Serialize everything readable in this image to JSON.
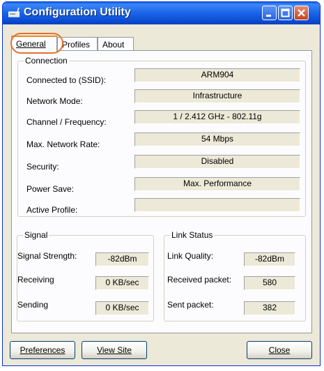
{
  "window": {
    "title": "Configuration Utility"
  },
  "tabs": [
    {
      "label": "General",
      "active": true
    },
    {
      "label": "Profiles",
      "active": false
    },
    {
      "label": "About",
      "active": false
    }
  ],
  "connection": {
    "title": "Connection",
    "rows": [
      {
        "label": "Connected to (SSID):",
        "value": "ARM904"
      },
      {
        "label": "Network Mode:",
        "value": "Infrastructure"
      },
      {
        "label": "Channel / Frequency:",
        "value": "1 / 2.412 GHz - 802.11g"
      },
      {
        "label": "Max. Network Rate:",
        "value": "54 Mbps"
      },
      {
        "label": "Security:",
        "value": "Disabled"
      },
      {
        "label": "Power Save:",
        "value": "Max. Performance"
      },
      {
        "label": "Active Profile:",
        "value": ""
      }
    ]
  },
  "signal": {
    "title": "Signal",
    "rows": [
      {
        "label": "Signal Strength:",
        "value": "-82dBm"
      },
      {
        "label": "Receiving",
        "value": "0 KB/sec"
      },
      {
        "label": "Sending",
        "value": "0 KB/sec"
      }
    ]
  },
  "link_status": {
    "title": "Link Status",
    "rows": [
      {
        "label": "Link Quality:",
        "value": "-82dBm"
      },
      {
        "label": "Received packet:",
        "value": "580"
      },
      {
        "label": "Sent packet:",
        "value": "382"
      }
    ]
  },
  "buttons": {
    "preferences": "Preferences",
    "view_site": "View Site",
    "close": "Close"
  },
  "colors": {
    "titlebar": "#0a5ee6",
    "tab_highlight": "#e6712b",
    "window_bg": "#ece9d8"
  }
}
